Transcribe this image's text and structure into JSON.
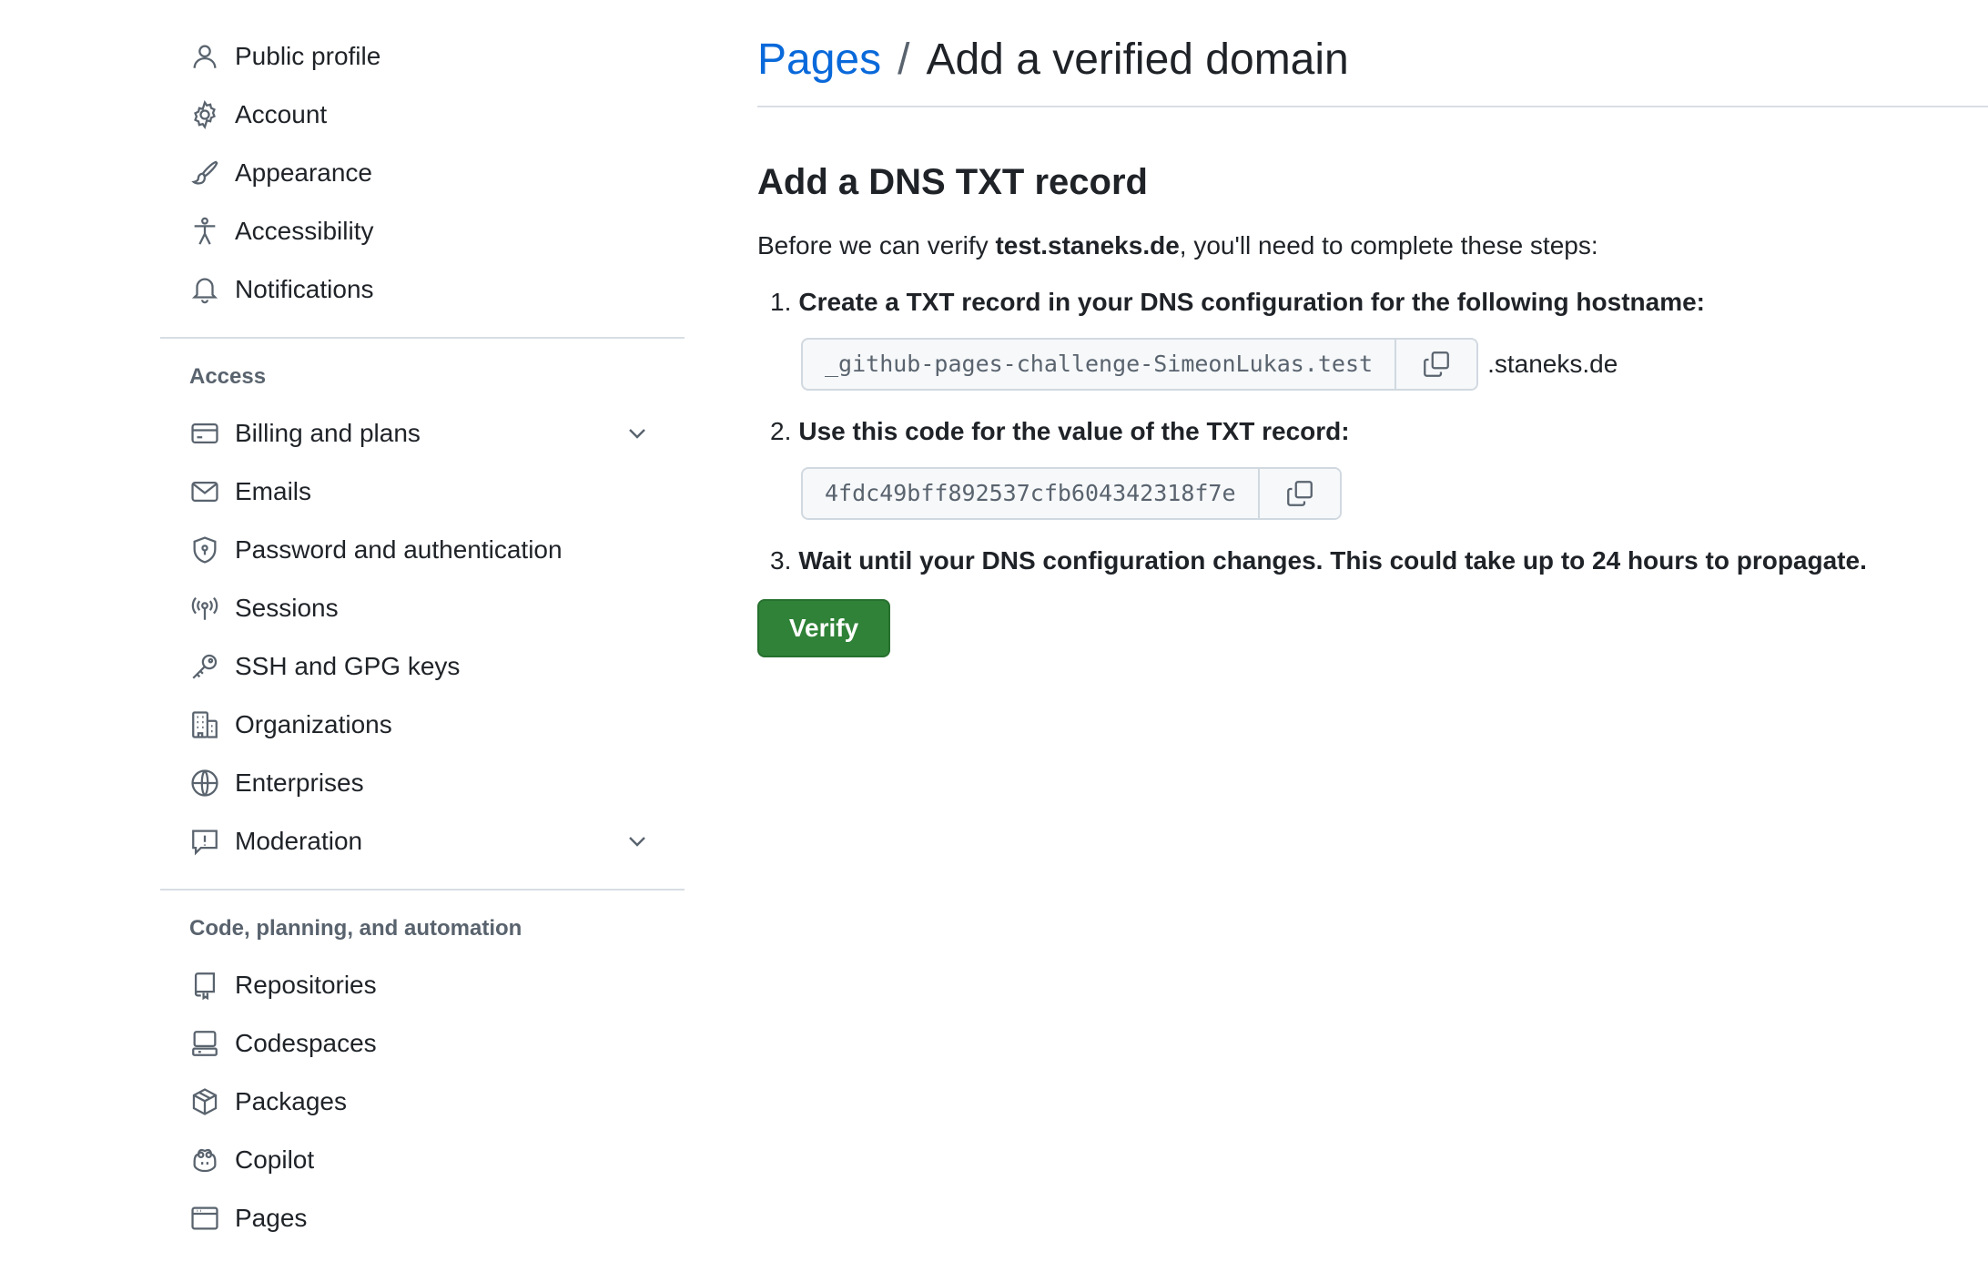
{
  "sidebar": {
    "top_items": [
      {
        "label": "Public profile",
        "icon": "person-icon"
      },
      {
        "label": "Account",
        "icon": "gear-icon"
      },
      {
        "label": "Appearance",
        "icon": "paintbrush-icon"
      },
      {
        "label": "Accessibility",
        "icon": "accessibility-icon"
      },
      {
        "label": "Notifications",
        "icon": "bell-icon"
      }
    ],
    "access": {
      "title": "Access",
      "items": [
        {
          "label": "Billing and plans",
          "icon": "credit-card-icon",
          "expandable": true
        },
        {
          "label": "Emails",
          "icon": "mail-icon"
        },
        {
          "label": "Password and authentication",
          "icon": "shield-lock-icon"
        },
        {
          "label": "Sessions",
          "icon": "broadcast-icon"
        },
        {
          "label": "SSH and GPG keys",
          "icon": "key-icon"
        },
        {
          "label": "Organizations",
          "icon": "organization-icon"
        },
        {
          "label": "Enterprises",
          "icon": "globe-icon"
        },
        {
          "label": "Moderation",
          "icon": "report-icon",
          "expandable": true
        }
      ]
    },
    "code": {
      "title": "Code, planning, and automation",
      "items": [
        {
          "label": "Repositories",
          "icon": "repo-icon"
        },
        {
          "label": "Codespaces",
          "icon": "codespaces-icon"
        },
        {
          "label": "Packages",
          "icon": "package-icon"
        },
        {
          "label": "Copilot",
          "icon": "copilot-icon"
        },
        {
          "label": "Pages",
          "icon": "browser-icon"
        }
      ]
    }
  },
  "header": {
    "breadcrumb_link": "Pages",
    "separator": "/",
    "title": "Add a verified domain"
  },
  "content": {
    "subhead": "Add a DNS TXT record",
    "intro_prefix": "Before we can verify ",
    "intro_domain": "test.staneks.de",
    "intro_suffix": ", you'll need to complete these steps:",
    "step1": {
      "num": "1.",
      "text": "Create a TXT record in your DNS configuration for the following hostname:"
    },
    "hostname_code": "_github-pages-challenge-SimeonLukas.test",
    "hostname_suffix": ".staneks.de",
    "step2": {
      "num": "2.",
      "text": "Use this code for the value of the TXT record:"
    },
    "value_code": "4fdc49bff892537cfb604342318f7e",
    "step3": {
      "num": "3.",
      "text": "Wait until your DNS configuration changes. This could take up to 24 hours to propagate."
    },
    "verify_label": "Verify"
  },
  "colors": {
    "accent_link": "#0969da",
    "verify_green": "#2f8237"
  }
}
